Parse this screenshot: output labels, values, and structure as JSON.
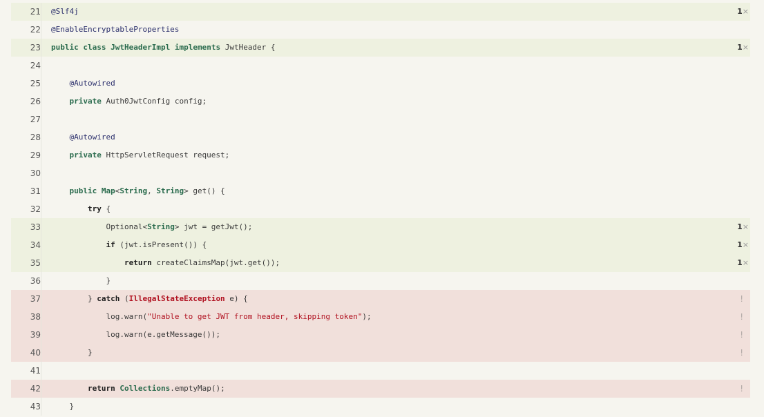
{
  "lines": [
    {
      "num": "21",
      "status": "covered",
      "hits": "1",
      "code": [
        {
          "t": "@Slf4j",
          "c": "ann"
        }
      ]
    },
    {
      "num": "22",
      "status": "none",
      "hits": "",
      "code": [
        {
          "t": "@EnableEncryptableProperties",
          "c": "ann"
        }
      ]
    },
    {
      "num": "23",
      "status": "covered",
      "hits": "1",
      "code": [
        {
          "t": "public",
          "c": "kw-g"
        },
        {
          "t": " "
        },
        {
          "t": "class",
          "c": "kw-g"
        },
        {
          "t": " "
        },
        {
          "t": "JwtHeaderImpl",
          "c": "kw-g"
        },
        {
          "t": " "
        },
        {
          "t": "implements",
          "c": "kw-g"
        },
        {
          "t": " JwtHeader {"
        }
      ]
    },
    {
      "num": "24",
      "status": "none",
      "hits": "",
      "code": []
    },
    {
      "num": "25",
      "status": "none",
      "hits": "",
      "code": [
        {
          "t": "    "
        },
        {
          "t": "@Autowired",
          "c": "ann"
        }
      ]
    },
    {
      "num": "26",
      "status": "none",
      "hits": "",
      "code": [
        {
          "t": "    "
        },
        {
          "t": "private",
          "c": "kw-g"
        },
        {
          "t": " Auth0JwtConfig config;"
        }
      ]
    },
    {
      "num": "27",
      "status": "none",
      "hits": "",
      "code": []
    },
    {
      "num": "28",
      "status": "none",
      "hits": "",
      "code": [
        {
          "t": "    "
        },
        {
          "t": "@Autowired",
          "c": "ann"
        }
      ]
    },
    {
      "num": "29",
      "status": "none",
      "hits": "",
      "code": [
        {
          "t": "    "
        },
        {
          "t": "private",
          "c": "kw-g"
        },
        {
          "t": " HttpServletRequest request;"
        }
      ]
    },
    {
      "num": "30",
      "status": "none",
      "hits": "",
      "code": []
    },
    {
      "num": "31",
      "status": "none",
      "hits": "",
      "code": [
        {
          "t": "    "
        },
        {
          "t": "public",
          "c": "kw-g"
        },
        {
          "t": " "
        },
        {
          "t": "Map",
          "c": "tyg"
        },
        {
          "t": "<"
        },
        {
          "t": "String",
          "c": "tyg"
        },
        {
          "t": ", "
        },
        {
          "t": "String",
          "c": "tyg"
        },
        {
          "t": "> get() {"
        }
      ]
    },
    {
      "num": "32",
      "status": "none",
      "hits": "",
      "code": [
        {
          "t": "        "
        },
        {
          "t": "try",
          "c": "kw"
        },
        {
          "t": " {"
        }
      ]
    },
    {
      "num": "33",
      "status": "covered",
      "hits": "1",
      "code": [
        {
          "t": "            Optional<"
        },
        {
          "t": "String",
          "c": "tyg"
        },
        {
          "t": "> jwt = getJwt();"
        }
      ]
    },
    {
      "num": "34",
      "status": "covered",
      "hits": "1",
      "code": [
        {
          "t": "            "
        },
        {
          "t": "if",
          "c": "kw"
        },
        {
          "t": " (jwt.isPresent()) {"
        }
      ]
    },
    {
      "num": "35",
      "status": "covered",
      "hits": "1",
      "code": [
        {
          "t": "                "
        },
        {
          "t": "return",
          "c": "kw"
        },
        {
          "t": " createClaimsMap(jwt.get());"
        }
      ]
    },
    {
      "num": "36",
      "status": "none",
      "hits": "",
      "code": [
        {
          "t": "            }"
        }
      ]
    },
    {
      "num": "37",
      "status": "missed",
      "hits": "",
      "code": [
        {
          "t": "        } "
        },
        {
          "t": "catch",
          "c": "kw"
        },
        {
          "t": " ("
        },
        {
          "t": "IllegalStateException",
          "c": "exc"
        },
        {
          "t": " e) {"
        }
      ]
    },
    {
      "num": "38",
      "status": "missed",
      "hits": "",
      "code": [
        {
          "t": "            log.warn("
        },
        {
          "t": "\"Unable to get JWT from header, skipping token\"",
          "c": "str"
        },
        {
          "t": ");"
        }
      ]
    },
    {
      "num": "39",
      "status": "missed",
      "hits": "",
      "code": [
        {
          "t": "            log.warn(e.getMessage());"
        }
      ]
    },
    {
      "num": "40",
      "status": "missed",
      "hits": "",
      "code": [
        {
          "t": "        }"
        }
      ]
    },
    {
      "num": "41",
      "status": "none",
      "hits": "",
      "code": []
    },
    {
      "num": "42",
      "status": "missed",
      "hits": "",
      "code": [
        {
          "t": "        "
        },
        {
          "t": "return",
          "c": "kw"
        },
        {
          "t": " "
        },
        {
          "t": "Collections",
          "c": "tyg"
        },
        {
          "t": ".emptyMap();"
        }
      ]
    },
    {
      "num": "43",
      "status": "none",
      "hits": "",
      "code": [
        {
          "t": "    }"
        }
      ]
    }
  ],
  "hit_suffix": "×",
  "miss_marker": "!"
}
